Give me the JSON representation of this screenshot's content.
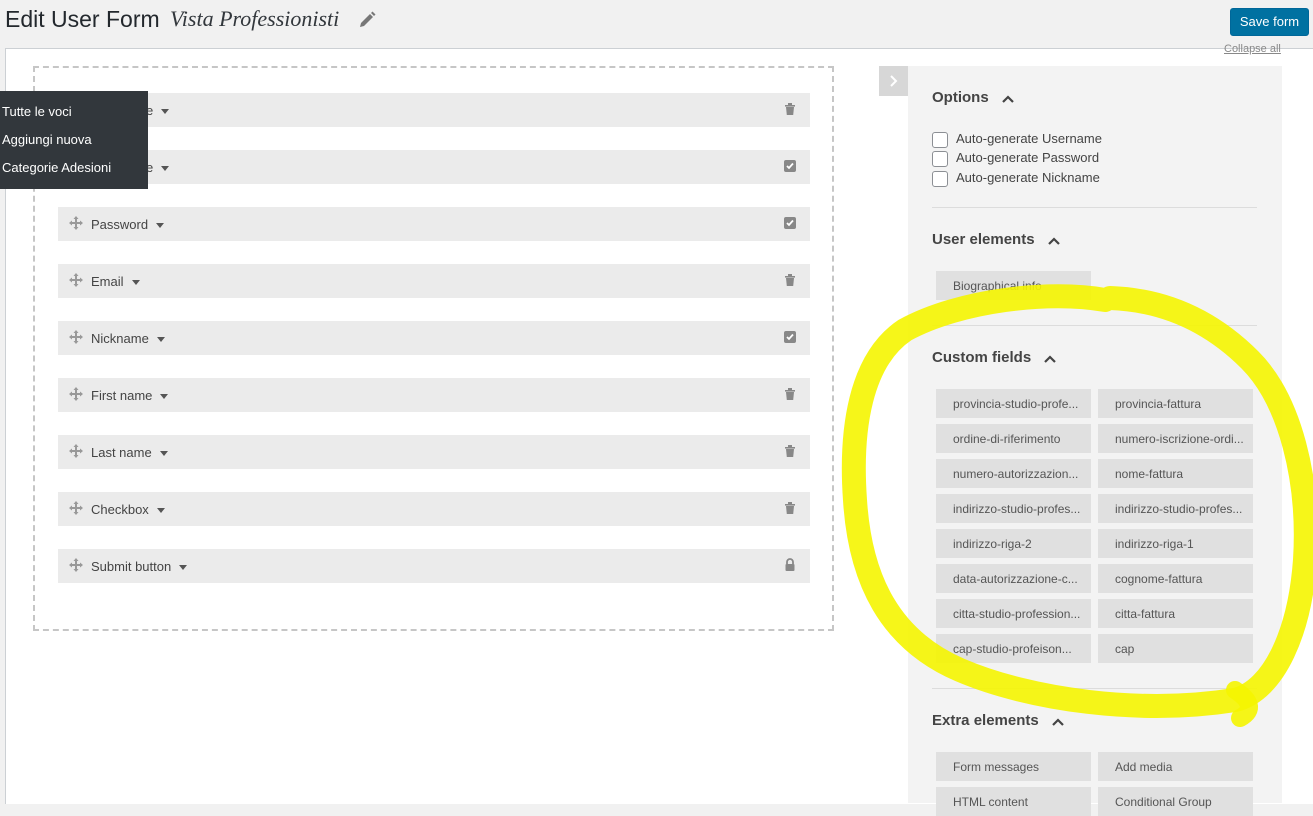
{
  "header": {
    "title": "Edit User Form",
    "form_name": "Vista Professionisti",
    "save_label": "Save form",
    "collapse_all": "Collapse all"
  },
  "dropdown_menu": {
    "items": [
      "Tutte le voci",
      "Aggiungi nuova",
      "Categorie Adesioni"
    ]
  },
  "form_fields": [
    {
      "label": "Username",
      "visible_label": "e",
      "action_icon": "trash-icon"
    },
    {
      "label": "Username",
      "visible_label": "e",
      "action_icon": "checkbox-icon"
    },
    {
      "label": "Password",
      "action_icon": "checkbox-icon"
    },
    {
      "label": "Email",
      "action_icon": "trash-icon"
    },
    {
      "label": "Nickname",
      "action_icon": "checkbox-icon"
    },
    {
      "label": "First name",
      "action_icon": "trash-icon"
    },
    {
      "label": "Last name",
      "action_icon": "trash-icon"
    },
    {
      "label": "Checkbox",
      "action_icon": "trash-icon"
    },
    {
      "label": "Submit button",
      "action_icon": "lock-icon"
    }
  ],
  "sidebar": {
    "options": {
      "title": "Options",
      "items": [
        "Auto-generate Username",
        "Auto-generate Password",
        "Auto-generate Nickname"
      ]
    },
    "user_elements": {
      "title": "User elements",
      "items": [
        "Biographical info"
      ]
    },
    "custom_fields": {
      "title": "Custom fields",
      "items": [
        "provincia-studio-profe...",
        "provincia-fattura",
        "ordine-di-riferimento",
        "numero-iscrizione-ordi...",
        "numero-autorizzazion...",
        "nome-fattura",
        "indirizzo-studio-profes...",
        "indirizzo-studio-profes...",
        "indirizzo-riga-2",
        "indirizzo-riga-1",
        "data-autorizzazione-c...",
        "cognome-fattura",
        "citta-studio-profession...",
        "citta-fattura",
        "cap-studio-profeison...",
        "cap"
      ]
    },
    "extra_elements": {
      "title": "Extra elements",
      "items": [
        "Form messages",
        "Add media",
        "HTML content",
        "Conditional Group"
      ]
    }
  },
  "colors": {
    "accent": "#0071a1",
    "highlight": "#f5f500",
    "menu_bg": "#32373c"
  }
}
